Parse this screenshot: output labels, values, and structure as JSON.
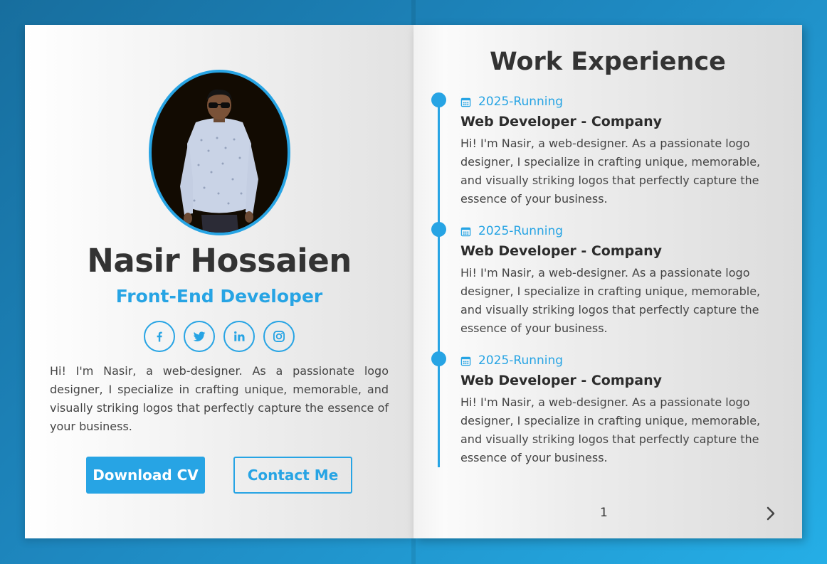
{
  "profile": {
    "name": "Nasir Hossaien",
    "role": "Front-End Developer",
    "bio": "Hi! I'm Nasir, a web-designer. As a passionate logo designer, I specialize in crafting unique, memorable, and visually striking logos that perfectly capture the essence of your business.",
    "socials": [
      {
        "icon": "facebook-icon"
      },
      {
        "icon": "twitter-icon"
      },
      {
        "icon": "linkedin-icon"
      },
      {
        "icon": "instagram-icon"
      }
    ],
    "buttons": {
      "download": "Download CV",
      "contact": "Contact Me"
    }
  },
  "experience": {
    "title": "Work Experience",
    "items": [
      {
        "date": "2025-Running",
        "title": "Web Developer - Company",
        "description": "Hi! I'm Nasir, a web-designer. As a passionate logo designer, I specialize in crafting unique, memorable, and visually striking logos that perfectly capture the essence of your business."
      },
      {
        "date": "2025-Running",
        "title": "Web Developer - Company",
        "description": "Hi! I'm Nasir, a web-designer. As a passionate logo designer, I specialize in crafting unique, memorable, and visually striking logos that perfectly capture the essence of your business."
      },
      {
        "date": "2025-Running",
        "title": "Web Developer - Company",
        "description": "Hi! I'm Nasir, a web-designer. As a passionate logo designer, I specialize in crafting unique, memorable, and visually striking logos that perfectly capture the essence of your business."
      }
    ]
  },
  "pagination": {
    "page": "1",
    "next_icon": "chevron-right-icon"
  },
  "colors": {
    "accent": "#27a4e4",
    "text": "#333333",
    "background_start": "#176e9e",
    "background_end": "#25aee6"
  }
}
